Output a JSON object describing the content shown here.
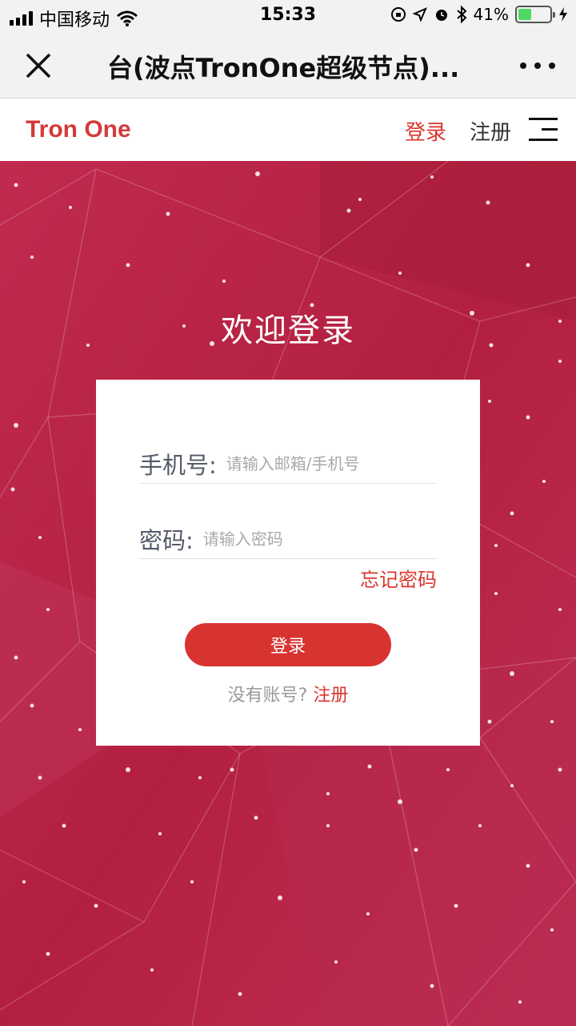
{
  "status_bar": {
    "carrier": "中国移动",
    "time": "15:33",
    "battery": "41%",
    "battery_level": 0.41,
    "icons": [
      "signal-icon",
      "wifi-icon",
      "orientation-lock-icon",
      "location-icon",
      "alarm-icon",
      "bluetooth-icon",
      "battery-icon",
      "charging-icon"
    ]
  },
  "nav_bar": {
    "title": "台(波点TronOne超级节点)...",
    "close_icon": "close-icon",
    "more_icon": "more-icon"
  },
  "header": {
    "logo": "Tron One",
    "login": "登录",
    "register": "注册",
    "menu_icon": "menu-icon"
  },
  "welcome": "欢迎登录",
  "form": {
    "phone_label": "手机号:",
    "phone_placeholder": "请输入邮箱/手机号",
    "phone_value": "",
    "password_label": "密码:",
    "password_placeholder": "请输入密码",
    "password_value": "",
    "forgot": "忘记密码",
    "submit": "登录",
    "no_account": "没有账号?",
    "register_link": "注册"
  },
  "colors": {
    "accent": "#d9362e",
    "background": "#b8244a"
  }
}
